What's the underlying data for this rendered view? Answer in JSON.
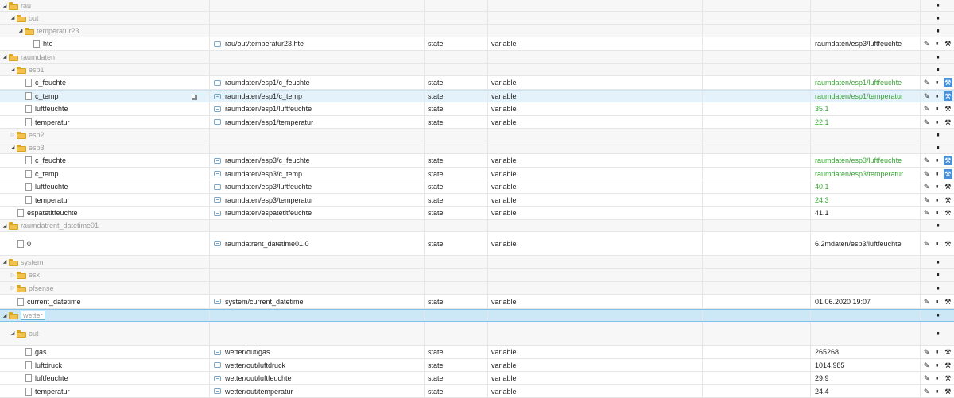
{
  "rows": [
    {
      "k": "folder",
      "l": 0,
      "o": true,
      "name": "rau",
      "h": 15
    },
    {
      "k": "folder",
      "l": 1,
      "o": true,
      "name": "out",
      "h": 16
    },
    {
      "k": "folder",
      "l": 2,
      "o": true,
      "name": "temperatur23",
      "h": 16
    },
    {
      "k": "state",
      "l": 3,
      "name": "hte",
      "id": "rau/out/temperatur23.hte",
      "type": "state",
      "role": "variable",
      "value": "raumdaten/esp3/luftfeuchte",
      "vc": "",
      "h": 17
    },
    {
      "k": "folder",
      "l": 0,
      "o": true,
      "name": "raumdaten",
      "h": 16
    },
    {
      "k": "folder",
      "l": 1,
      "o": true,
      "name": "esp1",
      "h": 16
    },
    {
      "k": "state",
      "l": 2,
      "name": "c_feuchte",
      "id": "raumdaten/esp1/c_feuchte",
      "type": "state",
      "role": "variable",
      "value": "raumdaten/esp1/luftfeuchte",
      "vc": "green",
      "wr": true,
      "h": 17
    },
    {
      "k": "state",
      "l": 2,
      "name": "c_temp",
      "id": "raumdaten/esp1/c_temp",
      "type": "state",
      "role": "variable",
      "value": "raumdaten/esp1/temperatur",
      "vc": "green",
      "wr": true,
      "hl": true,
      "copy": true,
      "h": 16
    },
    {
      "k": "state",
      "l": 2,
      "name": "luftfeuchte",
      "id": "raumdaten/esp1/luftfeuchte",
      "type": "state",
      "role": "variable",
      "value": "35.1",
      "vc": "green",
      "h": 17
    },
    {
      "k": "state",
      "l": 2,
      "name": "temperatur",
      "id": "raumdaten/esp1/temperatur",
      "type": "state",
      "role": "variable",
      "value": "22.1",
      "vc": "green",
      "h": 16
    },
    {
      "k": "folder",
      "l": 1,
      "o": false,
      "name": "esp2",
      "h": 16
    },
    {
      "k": "folder",
      "l": 1,
      "o": true,
      "name": "esp3",
      "h": 16
    },
    {
      "k": "state",
      "l": 2,
      "name": "c_feuchte",
      "id": "raumdaten/esp3/c_feuchte",
      "type": "state",
      "role": "variable",
      "value": "raumdaten/esp3/luftfeuchte",
      "vc": "green",
      "wr": true,
      "h": 17
    },
    {
      "k": "state",
      "l": 2,
      "name": "c_temp",
      "id": "raumdaten/esp3/c_temp",
      "type": "state",
      "role": "variable",
      "value": "raumdaten/esp3/temperatur",
      "vc": "green",
      "wr": true,
      "h": 16
    },
    {
      "k": "state",
      "l": 2,
      "name": "luftfeuchte",
      "id": "raumdaten/esp3/luftfeuchte",
      "type": "state",
      "role": "variable",
      "value": "40.1",
      "vc": "green",
      "h": 17
    },
    {
      "k": "state",
      "l": 2,
      "name": "temperatur",
      "id": "raumdaten/esp3/temperatur",
      "type": "state",
      "role": "variable",
      "value": "24.3",
      "vc": "green",
      "h": 16
    },
    {
      "k": "state",
      "l": 1,
      "name": "espatetitfeuchte",
      "id": "raumdaten/espatetitfeuchte",
      "type": "state",
      "role": "variable",
      "value": "41.1",
      "vc": "",
      "h": 17
    },
    {
      "k": "folder",
      "l": 0,
      "o": true,
      "name": "raumdatrent_datetime01",
      "h": 15
    },
    {
      "k": "state",
      "l": 1,
      "name": "0",
      "id": "raumdatrent_datetime01.0",
      "type": "state",
      "role": "variable",
      "value": "6.2mdaten/esp3/luftfeuchte",
      "vc": "",
      "h": 30
    },
    {
      "k": "folder",
      "l": 0,
      "o": true,
      "name": "system",
      "h": 16
    },
    {
      "k": "folder",
      "l": 1,
      "o": false,
      "name": "esx",
      "h": 17
    },
    {
      "k": "folder",
      "l": 1,
      "o": false,
      "name": "pfsense",
      "h": 16
    },
    {
      "k": "state",
      "l": 1,
      "name": "current_datetime",
      "id": "system/current_datetime",
      "type": "state",
      "role": "variable",
      "value": "01.06.2020 19:07",
      "vc": "",
      "h": 18
    },
    {
      "k": "folder",
      "l": 0,
      "o": true,
      "name": "wetter",
      "sel": true,
      "h": 16
    },
    {
      "k": "folder",
      "l": 1,
      "o": true,
      "name": "out",
      "h": 30
    },
    {
      "k": "state",
      "l": 2,
      "name": "gas",
      "id": "wetter/out/gas",
      "type": "state",
      "role": "variable",
      "value": "265268",
      "vc": "",
      "h": 17
    },
    {
      "k": "state",
      "l": 2,
      "name": "luftdruck",
      "id": "wetter/out/luftdruck",
      "type": "state",
      "role": "variable",
      "value": "1014.985",
      "vc": "",
      "h": 16
    },
    {
      "k": "state",
      "l": 2,
      "name": "luftfeuchte",
      "id": "wetter/out/luftfeuchte",
      "type": "state",
      "role": "variable",
      "value": "29.9",
      "vc": "",
      "h": 17
    },
    {
      "k": "state",
      "l": 2,
      "name": "temperatur",
      "id": "wetter/out/temperatur",
      "type": "state",
      "role": "variable",
      "value": "24.4",
      "vc": "",
      "h": 16
    }
  ],
  "icons": {
    "toggle_open": "triangle-down",
    "toggle_closed": "triangle-right",
    "folder": "folder-icon",
    "file": "file-icon",
    "edit": "pencil-icon",
    "delete": "trash-icon",
    "custom": "wrench-icon"
  },
  "colors": {
    "value_green": "#3aa535",
    "wrench_active": "#4a90d9",
    "row_selected": "#cce8f7",
    "row_hover": "#e3f2fb"
  }
}
